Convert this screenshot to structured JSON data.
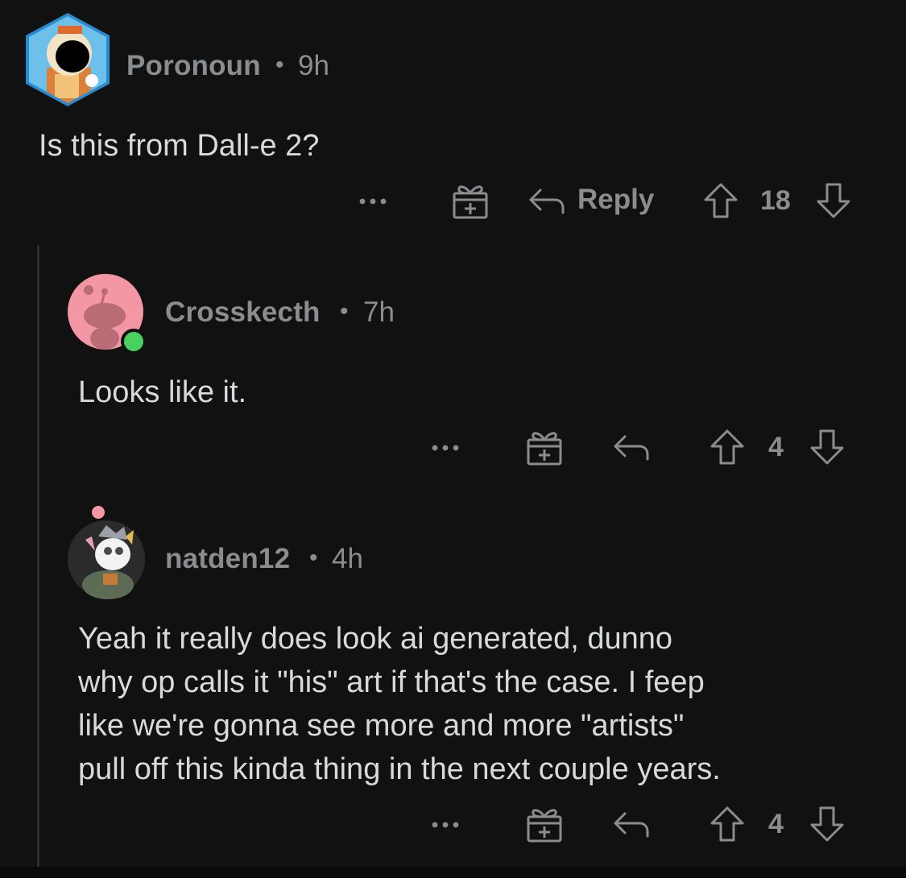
{
  "comments": [
    {
      "username": "Poronoun",
      "separator": "•",
      "time": "9h",
      "body": [
        "Is this from Dall-e 2?"
      ],
      "reply_label": "Reply",
      "score": "18",
      "more_label": "•••"
    },
    {
      "username": "Crosskecth",
      "separator": "•",
      "time": "7h",
      "body": [
        "Looks like it."
      ],
      "score": "4",
      "more_label": "•••"
    },
    {
      "username": "natden12",
      "separator": "•",
      "time": "4h",
      "body": [
        "Yeah it really does look ai generated, dunno",
        "why op calls it \"his\" art if that's the case.  I feep",
        "like we're gonna see more and more \"artists\"",
        "pull off this kinda thing in the next couple years."
      ],
      "score": "4",
      "more_label": "•••"
    }
  ],
  "colors": {
    "background": "#111111",
    "muted_text": "#8a8d90",
    "body_text": "#d7dadc",
    "thread_line": "#2d2d2f",
    "online_indicator": "#46d160",
    "snoo_avatar_bg": "#f497a5"
  },
  "icons": {
    "more": "more-options-icon",
    "award": "award-gift-icon",
    "reply": "reply-arrow-icon",
    "upvote": "upvote-arrow-icon",
    "downvote": "downvote-arrow-icon"
  }
}
